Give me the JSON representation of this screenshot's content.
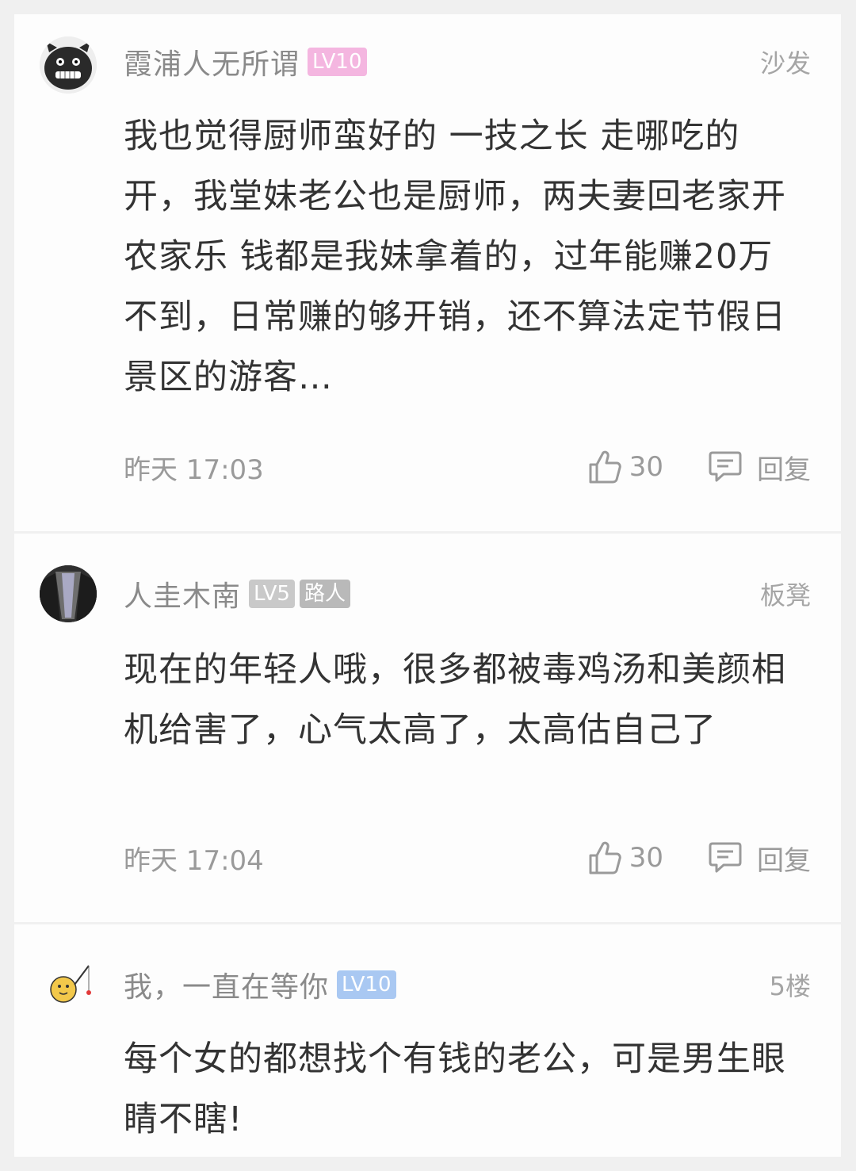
{
  "comments": [
    {
      "username": "霞浦人无所谓",
      "level": "LV10",
      "level_color": "#f4b6e0",
      "tag": "",
      "floor": "沙发",
      "content": "我也觉得厨师蛮好的 一技之长 走哪吃的开，我堂妹老公也是厨师，两夫妻回老家开农家乐 钱都是我妹拿着的，过年能赚20万不到，日常赚的够开销，还不算法定节假日景区的游客…",
      "time": "昨天 17:03",
      "likes": "30",
      "reply_label": "回复",
      "avatar_icon": "black-pig-avatar"
    },
    {
      "username": "人圭木南",
      "level": "LV5",
      "level_color": "#c9c9c9",
      "tag": "路人",
      "tag_color": "#b9b9b9",
      "floor": "板凳",
      "content": "现在的年轻人哦，很多都被毒鸡汤和美颜相机给害了，心气太高了，太高估自己了",
      "time": "昨天 17:04",
      "likes": "30",
      "reply_label": "回复",
      "avatar_icon": "tunnel-photo-avatar"
    },
    {
      "username": "我，一直在等你",
      "level": "LV10",
      "level_color": "#a9c8f2",
      "tag": "",
      "floor": "5楼",
      "content": "每个女的都想找个有钱的老公，可是男生眼睛不瞎!",
      "avatar_icon": "cartoon-fishing-avatar"
    }
  ]
}
